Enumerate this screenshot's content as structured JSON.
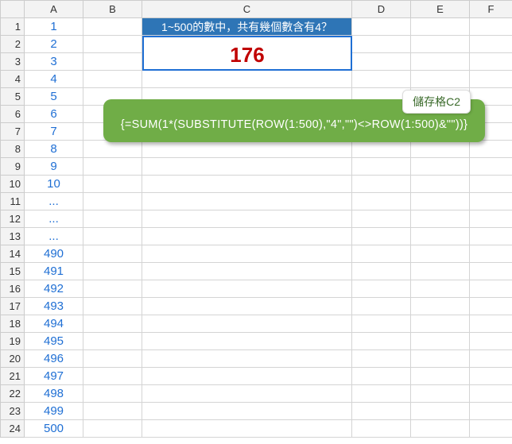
{
  "columns": [
    "A",
    "B",
    "C",
    "D",
    "E",
    "F"
  ],
  "header_cell": {
    "text": "1~500的數中，共有幾個數含有4？"
  },
  "result_cell": {
    "value": "176"
  },
  "col_a_values": [
    "1",
    "2",
    "3",
    "4",
    "5",
    "6",
    "7",
    "8",
    "9",
    "10",
    "...",
    "...",
    "...",
    "490",
    "491",
    "492",
    "493",
    "494",
    "495",
    "496",
    "497",
    "498",
    "499",
    "500"
  ],
  "callout": {
    "label": "儲存格C2",
    "formula": "{=SUM(1*(SUBSTITUTE(ROW(1:500),\"4\",\"\")<>ROW(1:500)&\"\"))}"
  }
}
